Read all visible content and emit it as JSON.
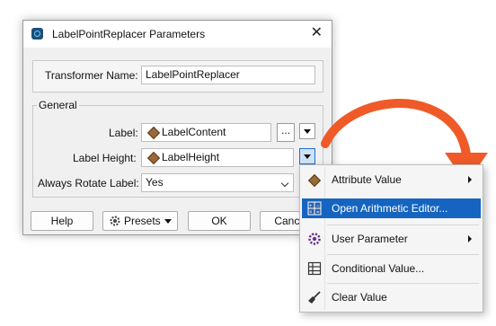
{
  "window": {
    "title": "LabelPointReplacer Parameters",
    "close_glyph": "✕"
  },
  "transformer_name": {
    "label": "Transformer Name:",
    "value": "LabelPointReplacer"
  },
  "general": {
    "legend": "General",
    "label": {
      "label": "Label:",
      "value": "LabelContent",
      "ellipsis": "..."
    },
    "label_height": {
      "label": "Label Height:",
      "value": "LabelHeight"
    },
    "always_rotate": {
      "label": "Always Rotate Label:",
      "value": "Yes"
    }
  },
  "buttons": {
    "help": "Help",
    "presets": "Presets",
    "ok": "OK",
    "cancel": "Cancel"
  },
  "menu": {
    "items": [
      {
        "label": "Attribute Value",
        "icon": "attribute-icon"
      },
      {
        "label": "Open Arithmetic Editor...",
        "icon": "arithmetic-editor-icon"
      },
      {
        "label": "User Parameter",
        "icon": "gear-icon"
      },
      {
        "label": "Conditional Value...",
        "icon": "table-icon"
      },
      {
        "label": "Clear Value",
        "icon": "broom-icon"
      }
    ]
  },
  "colors": {
    "accent": "#1565c0",
    "arrow": "#f05a28"
  }
}
